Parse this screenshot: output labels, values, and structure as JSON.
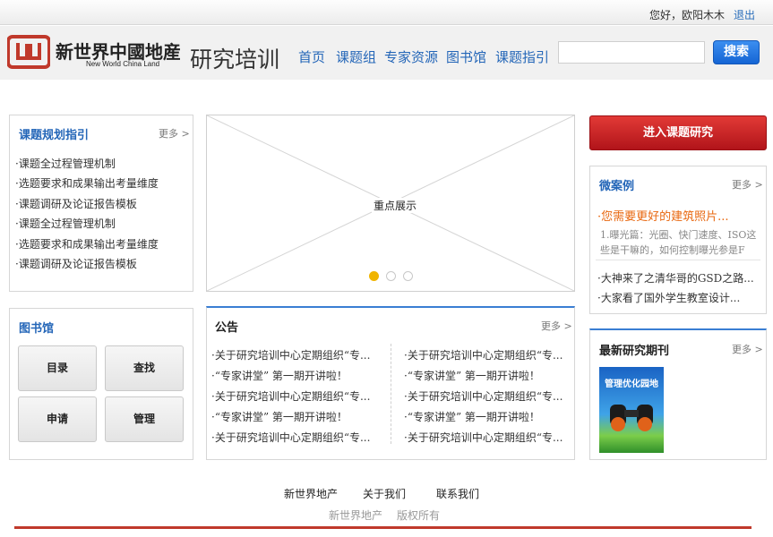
{
  "topbar": {
    "greeting": "您好，欧阳木木",
    "logout": "退出"
  },
  "header": {
    "logo_cn": "新世界中國地産",
    "logo_en": "New World China Land",
    "site_title": "研究培训",
    "nav": [
      "首页",
      "课题组",
      "专家资源",
      "图书馆",
      "课题指引"
    ],
    "search_placeholder": "",
    "search_label": "搜索"
  },
  "guide": {
    "title": "课题规划指引",
    "more": "更多 >",
    "items": [
      "·课题全过程管理机制",
      "·选题要求和成果输出考量维度",
      "·课题调研及论证报告模板",
      "·课题全过程管理机制",
      "·选题要求和成果输出考量维度",
      "·课题调研及论证报告模板"
    ]
  },
  "carousel": {
    "caption": "重点展示",
    "active_index": 0,
    "count": 3
  },
  "library": {
    "title": "图书馆",
    "buttons": [
      "目录",
      "查找",
      "申请",
      "管理"
    ]
  },
  "notice": {
    "title": "公告",
    "more": "更多 >",
    "left": [
      "·关于研究培训中心定期组织“专...",
      "·“专家讲堂” 第一期开讲啦！",
      "·关于研究培训中心定期组织“专...",
      "·“专家讲堂” 第一期开讲啦！",
      "·关于研究培训中心定期组织“专..."
    ],
    "right": [
      "·关于研究培训中心定期组织“专...",
      "·“专家讲堂” 第一期开讲啦！",
      "·关于研究培训中心定期组织“专...",
      "·“专家讲堂” 第一期开讲啦！",
      "·关于研究培训中心定期组织“专..."
    ]
  },
  "enter_button": "进入课题研究",
  "micro": {
    "title": "微案例",
    "more": "更多 >",
    "headline": "·您需要更好的建筑照片...",
    "summary_line1": "1.曝光篇：光圈、快门速度、ISO这",
    "summary_line2": "些是干嘛的，如何控制曝光参是F",
    "items": [
      "·大神来了之清华哥的GSD之路...",
      "·大家看了国外学生教室设计..."
    ]
  },
  "journal": {
    "title": "最新研究期刊",
    "more": "更多 >",
    "cover_text": "管理优化园地"
  },
  "footer": {
    "links": [
      "新世界地产",
      "关于我们",
      "联系我们"
    ],
    "sub": [
      "新世界地产",
      "版权所有"
    ]
  },
  "colors": {
    "brand_red": "#c0392b",
    "link_blue": "#2466b8",
    "accent_orange": "#e8670f",
    "dot_active": "#f0b400"
  }
}
